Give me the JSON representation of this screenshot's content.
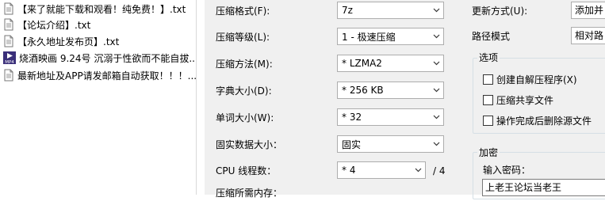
{
  "file_list": {
    "items": [
      {
        "name": "【来了就能下载和观看！纯免费！】.txt",
        "icon": "text-file-icon"
      },
      {
        "name": "【论坛介绍】.txt",
        "icon": "text-file-icon"
      },
      {
        "name": "【永久地址发布页】.txt",
        "icon": "text-file-icon"
      },
      {
        "name": "烧酒映画 9.24号 沉溺于性欲而不能自拔...",
        "icon": "mp4-video-icon",
        "icon_text": "MP4"
      },
      {
        "name": "最新地址及APP请发邮箱自动获取！！！...",
        "icon": "text-file-icon"
      }
    ]
  },
  "archive_dialog": {
    "format_label": "压缩格式(F):",
    "format_value": "7z",
    "level_label": "压缩等级(L):",
    "level_value": "1 - 极速压缩",
    "method_label": "压缩方法(M):",
    "method_value": "* LZMA2",
    "dict_label": "字典大小(D):",
    "dict_value": "* 256 KB",
    "word_label": "单词大小(W):",
    "word_value": "* 32",
    "solid_label": "固实数据大小：",
    "solid_value": "固实",
    "threads_label": "CPU 线程数：",
    "threads_value": "* 4",
    "threads_total": "/ 4",
    "memory_label": "压缩所需内存：",
    "update_label": "更新方式(U):",
    "update_value": "添加并",
    "path_label": "路径模式",
    "path_value": "相对路",
    "options_title": "选项",
    "opt_sfx": "创建自解压程序(X)",
    "opt_shared": "压缩共享文件",
    "opt_delete": "操作完成后删除源文件",
    "encryption_title": "加密",
    "password_label": "输入密码：",
    "password_value": "上老王论坛当老王"
  }
}
